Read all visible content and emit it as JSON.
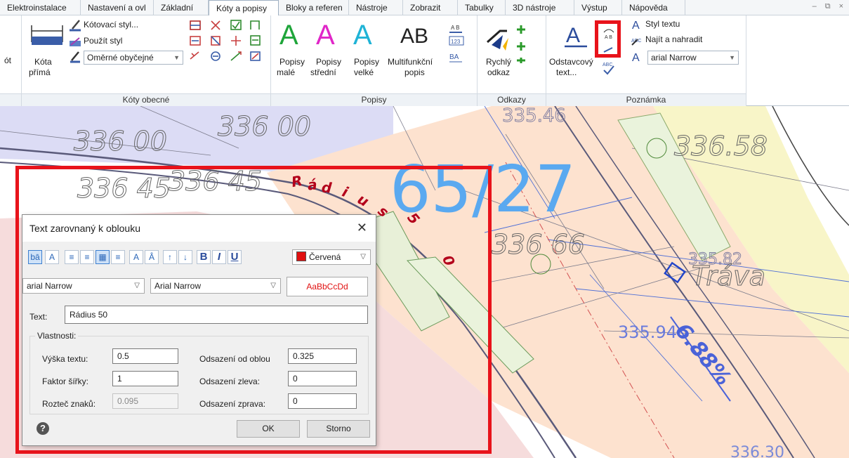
{
  "tabs": [
    {
      "label": "Elektroinstalace"
    },
    {
      "label": "Nastavení a ovl"
    },
    {
      "label": "Základní"
    },
    {
      "label": "Kóty a popisy"
    },
    {
      "label": "Bloky a referen"
    },
    {
      "label": "Nástroje"
    },
    {
      "label": "Zobrazit"
    },
    {
      "label": "Tabulky"
    },
    {
      "label": "3D nástroje"
    },
    {
      "label": "Výstup"
    },
    {
      "label": "Nápověda"
    }
  ],
  "window_controls": {
    "minimize": "–",
    "restore": "⧉",
    "close": "×"
  },
  "ribbon": {
    "left_stub": "ót",
    "koty": {
      "title": "Kóty obecné",
      "kota_label1": "Kóta",
      "kota_label2": "přímá",
      "kotovaci_styl": "Kótovací styl...",
      "pouzit_styl": "Použít styl",
      "style_combo": "Oměrné obyčejné"
    },
    "popisy": {
      "title": "Popisy",
      "btns": [
        {
          "l1": "Popisy",
          "l2": "malé"
        },
        {
          "l1": "Popisy",
          "l2": "střední"
        },
        {
          "l1": "Popisy",
          "l2": "velké"
        },
        {
          "l1": "Multifunkční",
          "l2": "popis"
        }
      ],
      "ab": "AB"
    },
    "odkazy": {
      "title": "Odkazy",
      "l1": "Rychlý",
      "l2": "odkaz"
    },
    "poznamka": {
      "title": "Poznámka",
      "odst_l1": "Odstavcový",
      "odst_l2": "text...",
      "styl_textu": "Styl textu",
      "najit": "Najít a nahradit",
      "font_combo": "arial Narrow"
    }
  },
  "canvas": {
    "labels": [
      "336 00",
      "336 00",
      "336 45",
      "336 45",
      "335.46",
      "336.58",
      "336 66",
      "335.82",
      "Tráva",
      "335.94",
      "6.88%",
      "336.30"
    ],
    "big_label": "65/27",
    "arc_text": "Rádius 50",
    "colors": {
      "blue_zone": "#dcdcf5",
      "orange_zone": "#fde2cf",
      "yellow_zone": "#f8f5c8",
      "pink_zone": "#f6dcdc",
      "red": "#b3001b",
      "big_blue": "#5aa9f0"
    }
  },
  "dialog": {
    "title": "Text zarovnaný k oblouku",
    "close": "✕",
    "color_select": "Červená",
    "color": "#e01010",
    "font1": "arial Narrow",
    "font2": "Arial Narrow",
    "preview": "AaBbCcDd",
    "text_label": "Text:",
    "text_value": "Rádius 50",
    "group_label": "Vlastnosti:",
    "vyska_label": "Výška textu:",
    "vyska_value": "0.5",
    "faktor_label": "Faktor šířky:",
    "faktor_value": "1",
    "roztec_label": "Rozteč znaků:",
    "roztec_value": "0.095",
    "odsaz_oblou_label": "Odsazení od oblou",
    "odsaz_oblou_value": "0.325",
    "odsaz_zleva_label": "Odsazení zleva:",
    "odsaz_zleva_value": "0",
    "odsaz_zprava_label": "Odsazení zprava:",
    "odsaz_zprava_value": "0",
    "ok": "OK",
    "cancel": "Storno"
  }
}
